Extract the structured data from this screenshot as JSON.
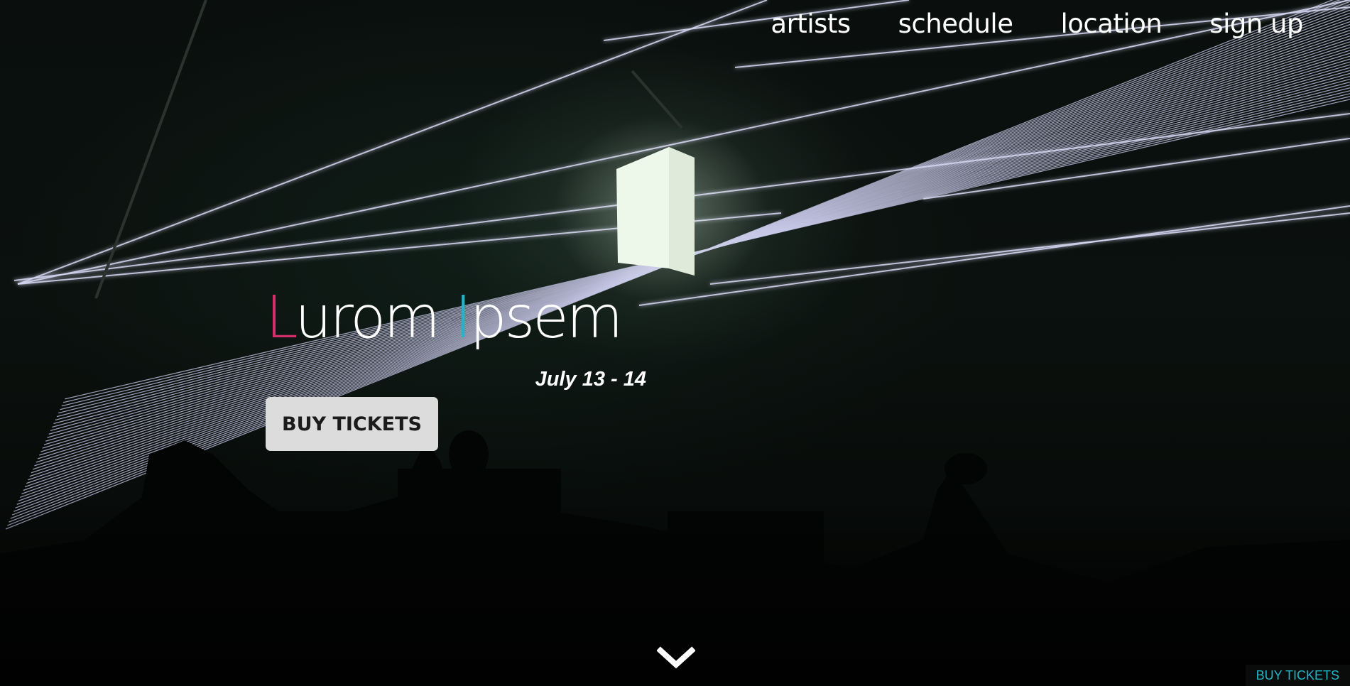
{
  "nav": {
    "items": [
      {
        "label": "artists"
      },
      {
        "label": "schedule"
      },
      {
        "label": "location"
      },
      {
        "label": "sign up"
      }
    ]
  },
  "hero": {
    "title_first_letter": "L",
    "title_first_rest": "urom ",
    "title_second_letter": "I",
    "title_second_rest": "psem",
    "date": "July 13 - 14",
    "cta_label": "BUY TICKETS"
  },
  "corner_cta": {
    "label": "BUY TICKETS"
  },
  "colors": {
    "accent_pink": "#d1306b",
    "accent_teal": "#1fb6c9",
    "button_bg": "#dcdcdc",
    "background": "#0a0f0d"
  },
  "icons": {
    "scroll": "chevron-down-icon"
  }
}
